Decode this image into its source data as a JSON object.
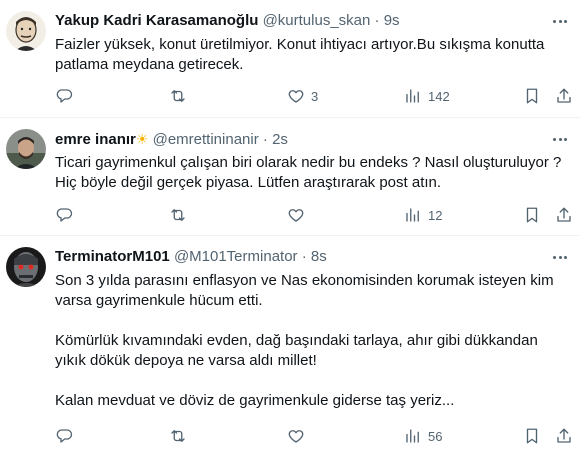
{
  "tweets": [
    {
      "name": "Yakup Kadri Karasamanoğlu",
      "handle": "@kurtulus_skan",
      "separator": "·",
      "time": "9s",
      "text": [
        "Faizler yüksek, konut üretilmiyor. Konut ihtiyacı artıyor.Bu sıkışma konutta",
        "patlama meydana getirecek."
      ],
      "replies": "",
      "retweets": "",
      "likes": "3",
      "views": "142"
    },
    {
      "name": "emre inanır",
      "emoji": "☀",
      "handle": "@emrettininanir",
      "separator": "·",
      "time": "2s",
      "text": [
        "Ticari gayrimenkul çalışan biri olarak nedir bu endeks ? Nasıl oluşturuluyor ?",
        "Hiç böyle değil gerçek piyasa. Lütfen araştırarak post atın."
      ],
      "replies": "",
      "retweets": "",
      "likes": "",
      "views": "12"
    },
    {
      "name": "TerminatorM101",
      "handle": "@M101Terminator",
      "separator": "·",
      "time": "8s",
      "text": [
        "Son 3 yılda parasını enflasyon ve Nas ekonomisinden korumak isteyen kim",
        "varsa gayrimenkule hücum etti.",
        "",
        "Kömürlük kıvamındaki evden, dağ başındaki tarlaya, ahır gibi dükkandan",
        "yıkık dökük depoya ne varsa aldı millet!",
        "",
        "Kalan mevduat ve döviz de gayrimenkule giderse taş yeriz..."
      ],
      "replies": "",
      "retweets": "",
      "likes": "",
      "views": "56"
    }
  ],
  "icons": {
    "reply": "reply-icon",
    "retweet": "retweet-icon",
    "like": "heart-icon",
    "views": "views-chart-icon",
    "bookmark": "bookmark-icon",
    "share": "share-icon",
    "more": "more-options-icon"
  },
  "colors": {
    "text": "#0f1419",
    "secondary": "#536471",
    "divider": "#eff3f4",
    "sun": "#f4b400"
  }
}
